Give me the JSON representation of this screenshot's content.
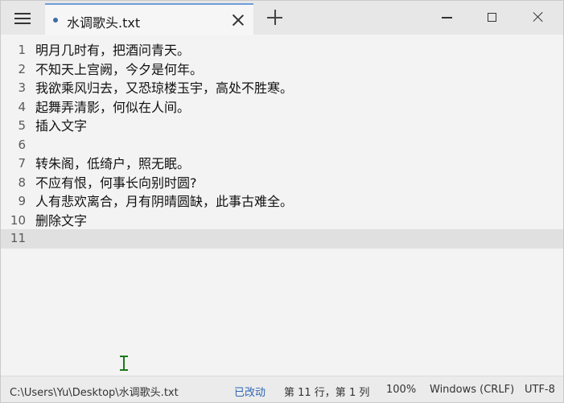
{
  "window": {
    "tab_title": "水调歌头.txt"
  },
  "editor": {
    "lines": [
      {
        "num": "1",
        "text": "明月几时有，把酒问青天。"
      },
      {
        "num": "2",
        "text": "不知天上宫阙，今夕是何年。"
      },
      {
        "num": "3",
        "text": "我欲乘风归去，又恐琼楼玉宇，高处不胜寒。"
      },
      {
        "num": "4",
        "text": "起舞弄清影，何似在人间。"
      },
      {
        "num": "5",
        "text": "插入文字"
      },
      {
        "num": "6",
        "text": ""
      },
      {
        "num": "7",
        "text": "转朱阁，低绮户，照无眠。"
      },
      {
        "num": "8",
        "text": "不应有恨，何事长向别时圆?"
      },
      {
        "num": "9",
        "text": "人有悲欢离合，月有阴晴圆缺，此事古难全。"
      },
      {
        "num": "10",
        "text": "删除文字"
      },
      {
        "num": "11",
        "text": ""
      }
    ]
  },
  "status": {
    "path": "C:\\Users\\Yu\\Desktop\\水调歌头.txt",
    "modified": "已改动",
    "position": "第 11 行，第 1 列",
    "zoom": "100%",
    "line_ending": "Windows (CRLF)",
    "encoding": "UTF-8"
  },
  "colors": {
    "accent": "#6d9ed6",
    "modified_text": "#2f66b3",
    "current_line": "#e0e0e0"
  },
  "icons": [
    "hamburger-menu-icon",
    "unsaved-dot-icon",
    "close-icon",
    "plus-icon",
    "minimize-icon",
    "maximize-icon",
    "window-close-icon",
    "text-cursor-icon"
  ]
}
